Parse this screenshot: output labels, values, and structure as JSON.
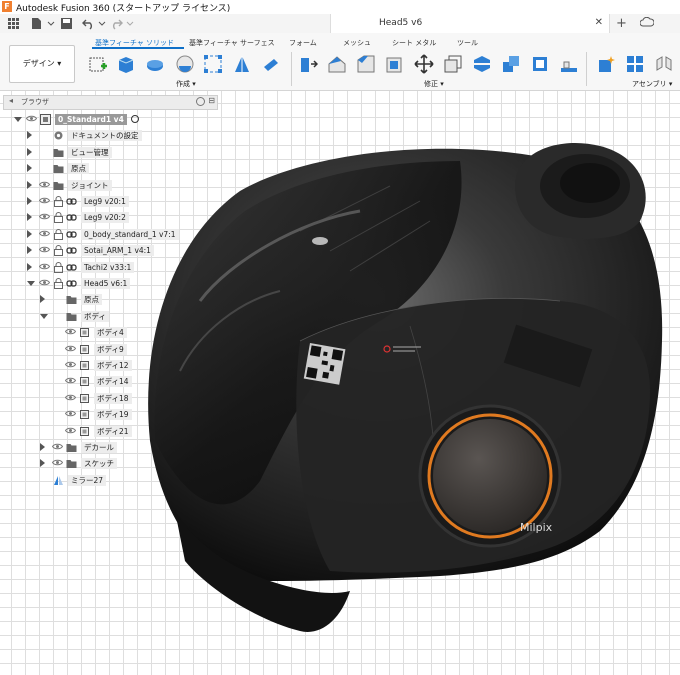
{
  "app": {
    "title": "Autodesk Fusion 360 (スタートアップ ライセンス)",
    "icon_letter": "F",
    "document_tab": "Head5 v6"
  },
  "ribbon": {
    "workspace": "デザイン ▾",
    "tabs": [
      "基準フィーチャ ソリッド",
      "基準フィーチャ サーフェス",
      "フォーム",
      "メッシュ",
      "シート メタル",
      "ツール"
    ],
    "active_tab": 0,
    "groups": [
      "作成 ▾",
      "修正 ▾",
      "アセンブリ ▾"
    ]
  },
  "browser": {
    "title": "ブラウザ",
    "items": [
      {
        "label": "0_Standard1 v4",
        "icon": "component-icon",
        "selected": true
      },
      {
        "label": "ドキュメントの設定",
        "icon": "gear-icon"
      },
      {
        "label": "ビュー管理",
        "icon": "folder-icon"
      },
      {
        "label": "原点",
        "icon": "folder-icon"
      },
      {
        "label": "ジョイント",
        "icon": "folder-icon"
      },
      {
        "label": "Leg9 v20:1",
        "icon": "link-icon"
      },
      {
        "label": "Leg9 v20:2",
        "icon": "link-icon"
      },
      {
        "label": "0_body_standard_1 v7:1",
        "icon": "link-icon"
      },
      {
        "label": "Sotai_ARM_1 v4:1",
        "icon": "link-icon"
      },
      {
        "label": "Tachi2 v33:1",
        "icon": "link-icon"
      },
      {
        "label": "Head5 v6:1",
        "icon": "link-icon"
      },
      {
        "label": "原点",
        "icon": "folder-icon"
      },
      {
        "label": "ボディ",
        "icon": "folder-icon"
      },
      {
        "label": "ボディ4",
        "icon": "body-icon"
      },
      {
        "label": "ボディ9",
        "icon": "body-icon"
      },
      {
        "label": "ボディ12",
        "icon": "body-icon"
      },
      {
        "label": "ボディ14",
        "icon": "body-icon"
      },
      {
        "label": "ボディ18",
        "icon": "body-icon"
      },
      {
        "label": "ボディ19",
        "icon": "body-icon"
      },
      {
        "label": "ボディ21",
        "icon": "body-icon"
      },
      {
        "label": "デカール",
        "icon": "folder-icon"
      },
      {
        "label": "スケッチ",
        "icon": "folder-icon"
      },
      {
        "label": "ミラー27",
        "icon": "mirror-icon"
      }
    ]
  },
  "model": {
    "decal_text": "Milpix",
    "accent": "#e07a20"
  },
  "colors": {
    "accent": "#0f70c8",
    "grid": "#dedede"
  }
}
